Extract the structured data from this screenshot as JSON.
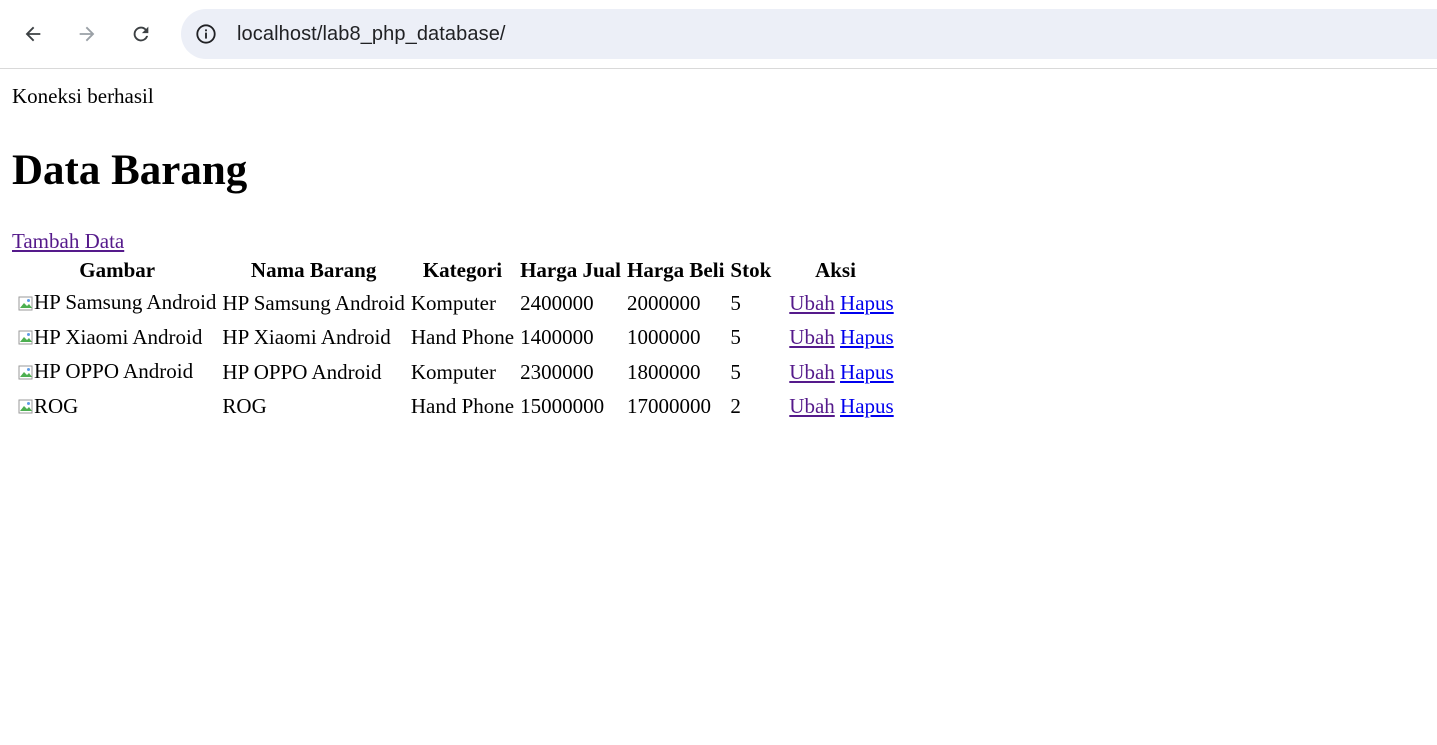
{
  "browser": {
    "url": "localhost/lab8_php_database/"
  },
  "page": {
    "status": "Koneksi berhasil",
    "title": "Data Barang",
    "add_link": "Tambah Data"
  },
  "table": {
    "headers": [
      "Gambar",
      "Nama Barang",
      "Kategori",
      "Harga Jual",
      "Harga Beli",
      "Stok",
      "Aksi"
    ],
    "rows": [
      {
        "gambar_alt": "HP Samsung Android",
        "nama": "HP Samsung Android",
        "kategori": "Komputer",
        "harga_jual": "2400000",
        "harga_beli": "2000000",
        "stok": "5",
        "ubah": "Ubah",
        "hapus": "Hapus"
      },
      {
        "gambar_alt": "HP Xiaomi Android",
        "nama": "HP Xiaomi Android",
        "kategori": "Hand Phone",
        "harga_jual": "1400000",
        "harga_beli": "1000000",
        "stok": "5",
        "ubah": "Ubah",
        "hapus": "Hapus"
      },
      {
        "gambar_alt": "HP OPPO Android",
        "nama": "HP OPPO Android",
        "kategori": "Komputer",
        "harga_jual": "2300000",
        "harga_beli": "1800000",
        "stok": "5",
        "ubah": "Ubah",
        "hapus": "Hapus"
      },
      {
        "gambar_alt": "ROG",
        "nama": "ROG",
        "kategori": "Hand Phone",
        "harga_jual": "15000000",
        "harga_beli": "17000000",
        "stok": "2",
        "ubah": "Ubah",
        "hapus": "Hapus"
      }
    ]
  },
  "colors": {
    "visited_link": "#551a8b",
    "unvisited_link": "#0000ee",
    "omnibox_bg": "#eceff7"
  }
}
